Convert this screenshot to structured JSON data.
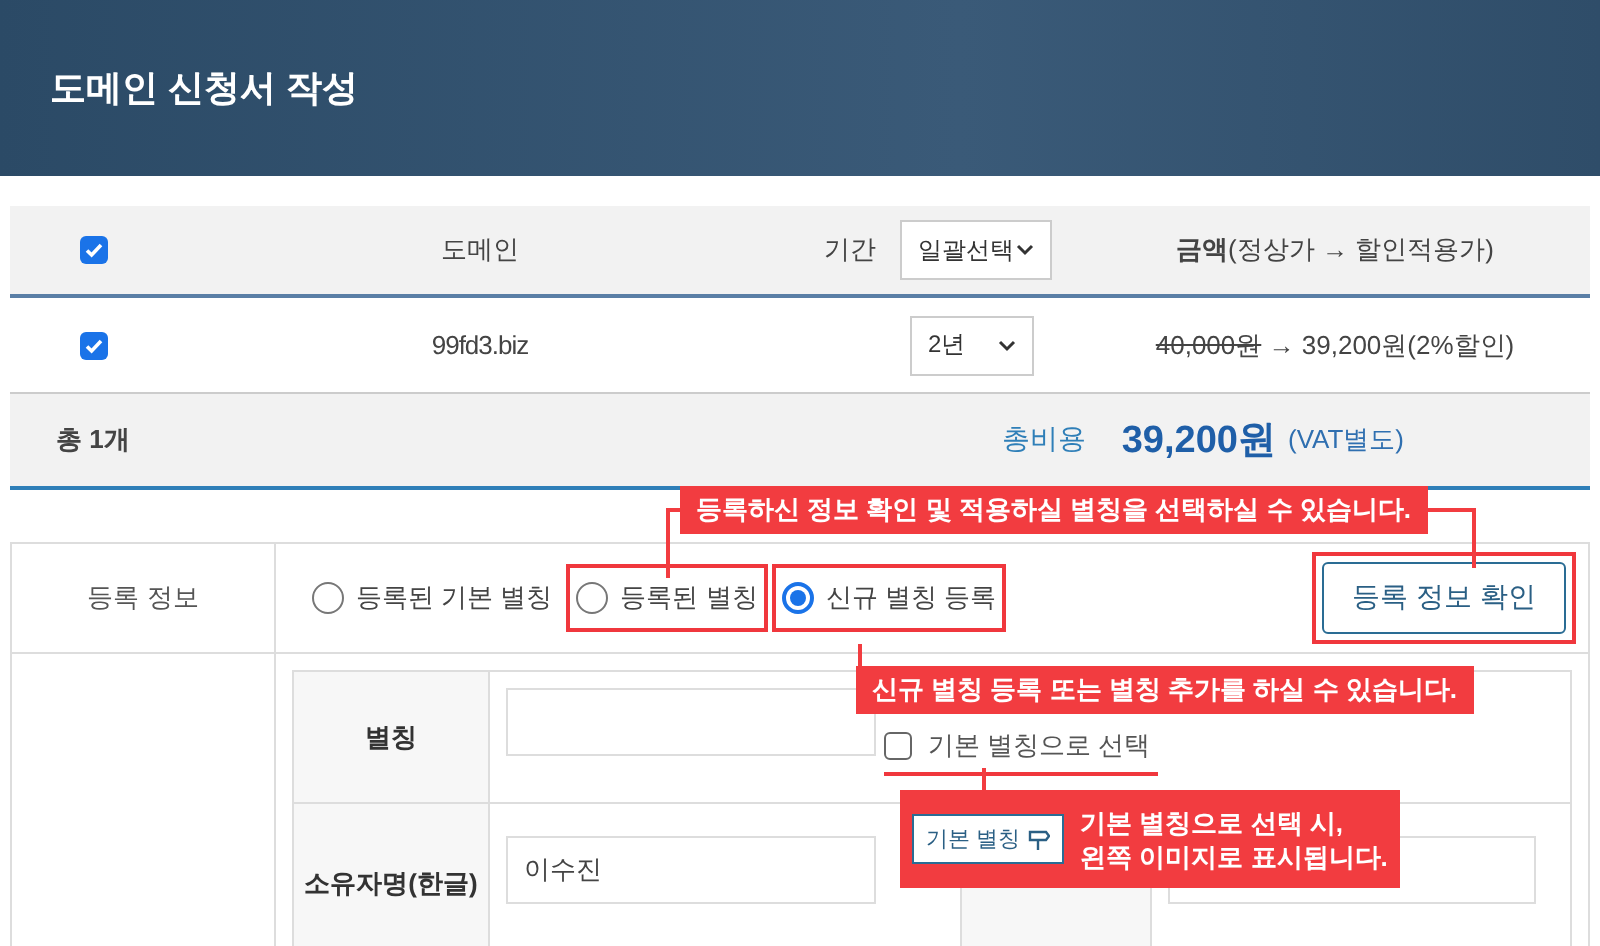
{
  "header": {
    "title": "도메인 신청서 작성"
  },
  "domain_table": {
    "all_checked": true,
    "columns": {
      "domain": "도메인",
      "period": "기간",
      "bulk_select": "일괄선택",
      "amount_bold": "금액",
      "amount_note": "(정상가 → 할인적용가)"
    },
    "rows": [
      {
        "checked": true,
        "domain": "99fd3.biz",
        "period": "2년",
        "original_price": "40,000원",
        "arrow": "→",
        "discounted": "39,200원(2%할인)"
      }
    ],
    "total": {
      "count": "총 1개",
      "label": "총비용",
      "amount": "39,200원",
      "note": "(VAT별도)"
    }
  },
  "registration": {
    "label": "등록 정보",
    "options": [
      {
        "label": "등록된 기본 별칭",
        "selected": false,
        "highlighted": false
      },
      {
        "label": "등록된 별칭",
        "selected": false,
        "highlighted": true
      },
      {
        "label": "신규 별칭 등록",
        "selected": true,
        "highlighted": true
      }
    ],
    "confirm_button": "등록 정보 확인"
  },
  "form": {
    "alias_label": "별칭",
    "default_checkbox": {
      "label": "기본 별칭으로 선택",
      "checked": false
    },
    "owner_kr_label": "소유자명(한글)",
    "owner_kr_value": "이수진"
  },
  "callouts": [
    {
      "text": "등록하신 정보 확인 및 적용하실 별칭을 선택하실 수 있습니다."
    },
    {
      "text": "신규 별칭 등록 또는 별칭 추가를 하실 수 있습니다."
    },
    {
      "badge": "기본 별칭",
      "lines": [
        "기본 별칭으로 선택 시,",
        "왼쪽 이미지로 표시됩니다."
      ]
    }
  ]
}
